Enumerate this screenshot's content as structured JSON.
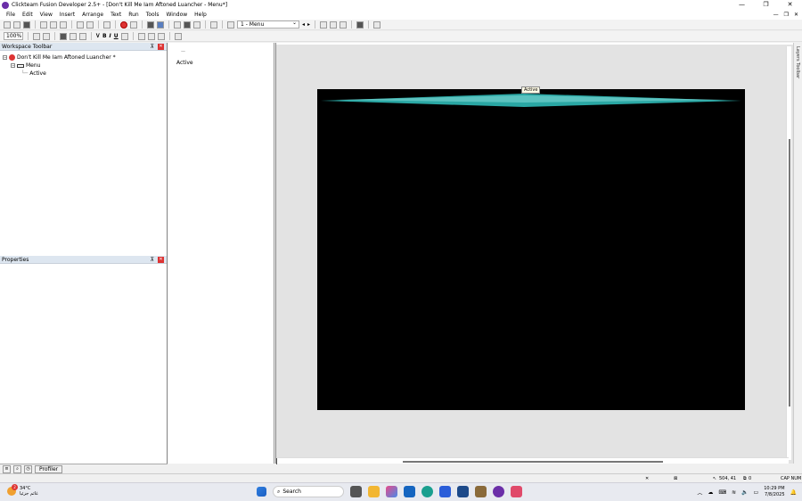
{
  "window": {
    "title": "Clickteam Fusion Developer 2.5+ - [Don't Kill Me Iam Aftoned Luancher - Menu*]",
    "controls": [
      "—",
      "❐",
      "✕"
    ]
  },
  "menu": {
    "items": [
      "File",
      "Edit",
      "View",
      "Insert",
      "Arrange",
      "Text",
      "Run",
      "Tools",
      "Window",
      "Help"
    ],
    "mdi_controls": [
      "—",
      "❐",
      "✕"
    ]
  },
  "toolbar": {
    "frame_select": "1 - Menu",
    "zoom": "100%",
    "bold": "B",
    "italic": "I",
    "underline": "U"
  },
  "workspace": {
    "title": "Workspace Toolbar",
    "pin": "⊼",
    "close": "✕",
    "tree": {
      "app": "Don't Kill Me Iam Aftoned Luancher *",
      "frame": "Menu",
      "object": "Active"
    }
  },
  "properties": {
    "title": "Properties",
    "pin": "⊼",
    "close": "✕"
  },
  "objects_panel": {
    "dash": "—",
    "item": "Active"
  },
  "editor": {
    "active_tag": "Active",
    "canvas_bg": "#000000",
    "shape_color": "#2aa7a4"
  },
  "layers": {
    "label": "Layers Toolbar"
  },
  "bottom_tabs": {
    "profiler": "Profiler"
  },
  "status": {
    "x": "✕",
    "coords": "504, 41",
    "count": "0",
    "keys": "CAP NUM"
  },
  "taskbar": {
    "temp": "34°C",
    "weather_text": "غائم جزئيا",
    "badge": "2",
    "search": "Search",
    "time": "10:29 PM",
    "date": "7/8/2025"
  }
}
